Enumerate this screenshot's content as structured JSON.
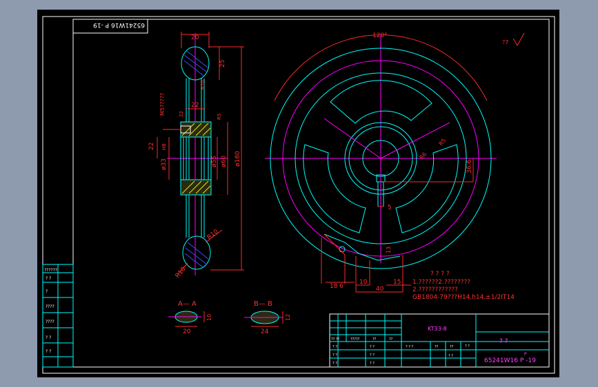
{
  "colors": {
    "background": "#8e9aae",
    "drawing_area": "#000000",
    "frame": "#ffffff",
    "outline": "#00ffff",
    "dimension": "#ff2a2a",
    "centerline": "#ff00ff",
    "hatch": "#3b4bff",
    "hatch_fill": "#e8e800"
  },
  "drawing_code_rotated": "65241W16 P -19",
  "roughness_note": "?7",
  "side_view": {
    "dim_top_width": "20",
    "dim_rim_height": "25",
    "dim_overall": "180",
    "dim_hub_width": "22",
    "dim_fit_top": "22",
    "dim_left": "22",
    "dia_bore": "ø33",
    "dia_55": "ø55",
    "dia_60": "ø60",
    "dia_180": "ø180",
    "radius_r10_top": "R10",
    "radius_r10_bottom": "R10",
    "note_m": "M5?????",
    "fit_code": "H8",
    "r_label_1": "R10",
    "r_label_2": "R5"
  },
  "front_view": {
    "angle": "120°",
    "dim_36_6": "36.6",
    "dim_r5": "R5",
    "dim_r6": "R6",
    "dim_5": "5",
    "dim_18": "18",
    "dim_6": "6",
    "dim_10": "10",
    "dim_40": "40",
    "dim_15": "15",
    "dim_13": "13"
  },
  "notes": {
    "heading": "? ? ? ?",
    "line1": "1.??????2.????????",
    "line2": "2.????????????",
    "line3": "GB1804-79???H14,h14,±1/2IT14"
  },
  "sections": [
    {
      "title": "A— A",
      "width": "20",
      "height": "10"
    },
    {
      "title": "B— B",
      "width": "24",
      "height": "12"
    }
  ],
  "revision_block": {
    "rows": [
      "??????",
      "?  ?",
      "?",
      "????",
      "????",
      "?  ?",
      "?  ?"
    ]
  },
  "title_block": {
    "material": "KT33-8",
    "title": "?   ?",
    "drawing_no": "65241W16 P -19",
    "drawing_no_sup": "P",
    "header_cells": [
      "?? ??",
      "?????",
      "??",
      "??",
      "? ?"
    ],
    "row_cells": [
      [
        "?  ?",
        "?  ?"
      ],
      [
        "?  ?",
        "?  ?"
      ],
      [
        "?  ?",
        "?  ?"
      ]
    ],
    "scale_cells": [
      "?  ?  ?",
      "??",
      "??",
      "?  ?"
    ]
  }
}
